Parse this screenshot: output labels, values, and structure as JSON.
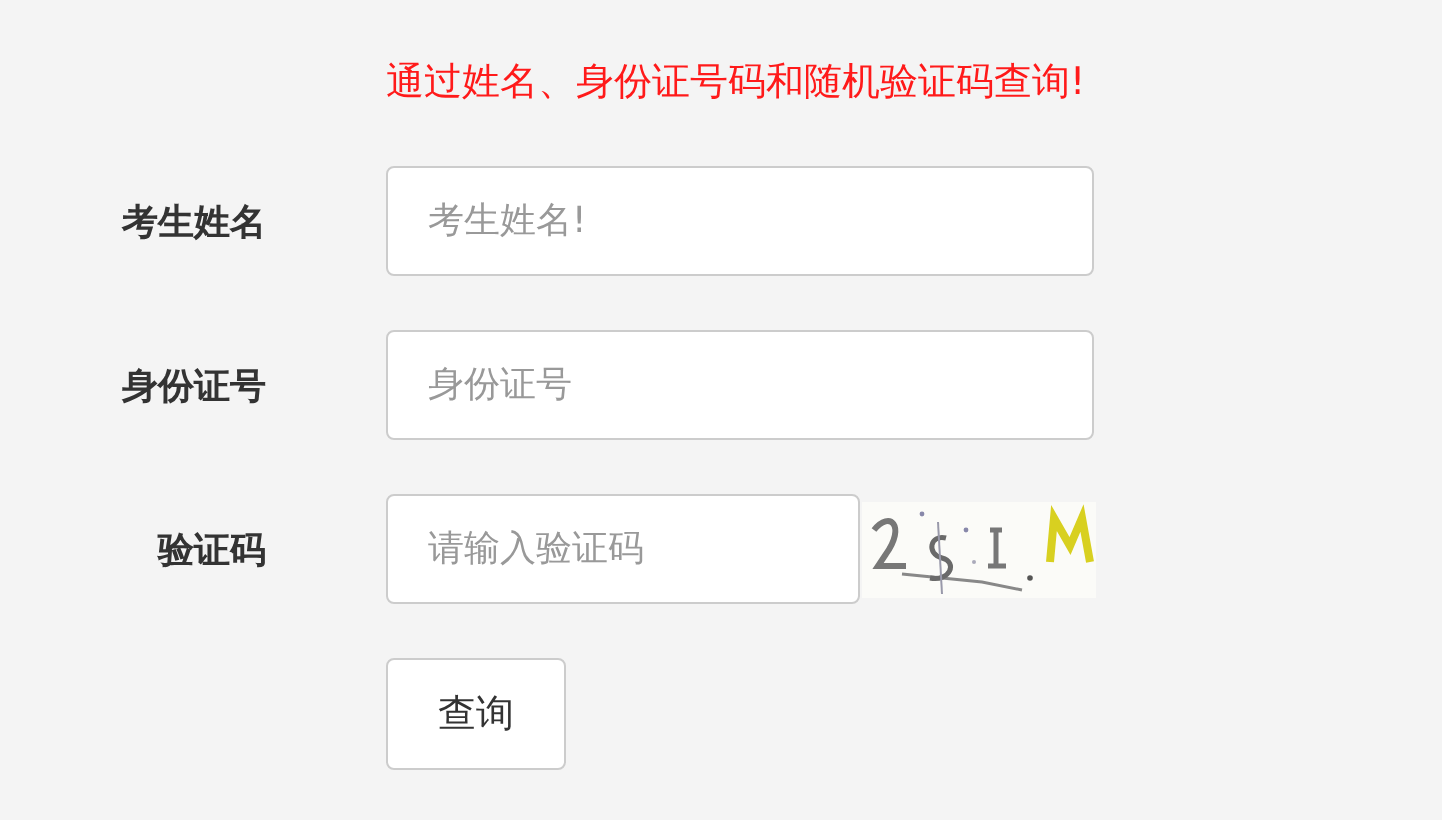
{
  "notice": "通过姓名、身份证号码和随机验证码查询!",
  "fields": [
    {
      "kind": "text",
      "label": "考生姓名",
      "placeholder": "考生姓名!"
    },
    {
      "kind": "text",
      "label": "身份证号",
      "placeholder": "身份证号"
    },
    {
      "kind": "captcha",
      "label": "验证码",
      "placeholder": "请输入验证码"
    }
  ],
  "submit": "查询"
}
